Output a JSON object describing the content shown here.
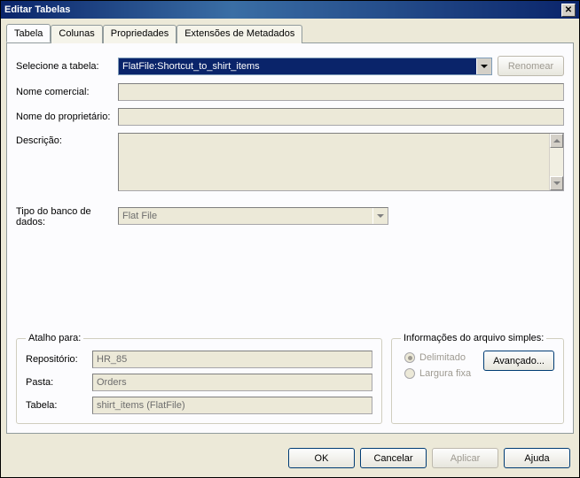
{
  "window": {
    "title": "Editar Tabelas"
  },
  "tabs": {
    "items": [
      "Tabela",
      "Colunas",
      "Propriedades",
      "Extensões de Metadados"
    ],
    "active": 0
  },
  "form": {
    "select_table_label": "Selecione a tabela:",
    "select_table_value": "FlatFile:Shortcut_to_shirt_items",
    "rename_button": "Renomear",
    "business_name_label": "Nome comercial:",
    "business_name_value": "",
    "owner_label": "Nome do proprietário:",
    "owner_value": "",
    "description_label": "Descrição:",
    "description_value": "",
    "db_type_label": "Tipo do banco de dados:",
    "db_type_value": "Flat File"
  },
  "shortcut": {
    "legend": "Atalho para:",
    "repo_label": "Repositório:",
    "repo_value": "HR_85",
    "folder_label": "Pasta:",
    "folder_value": "Orders",
    "table_label": "Tabela:",
    "table_value": "shirt_items (FlatFile)"
  },
  "fileinfo": {
    "legend": "Informações do arquivo simples:",
    "opt_delimited": "Delimitado",
    "opt_fixed": "Largura fixa",
    "advanced_button": "Avançado..."
  },
  "footer": {
    "ok": "OK",
    "cancel": "Cancelar",
    "apply": "Aplicar",
    "help": "Ajuda"
  }
}
